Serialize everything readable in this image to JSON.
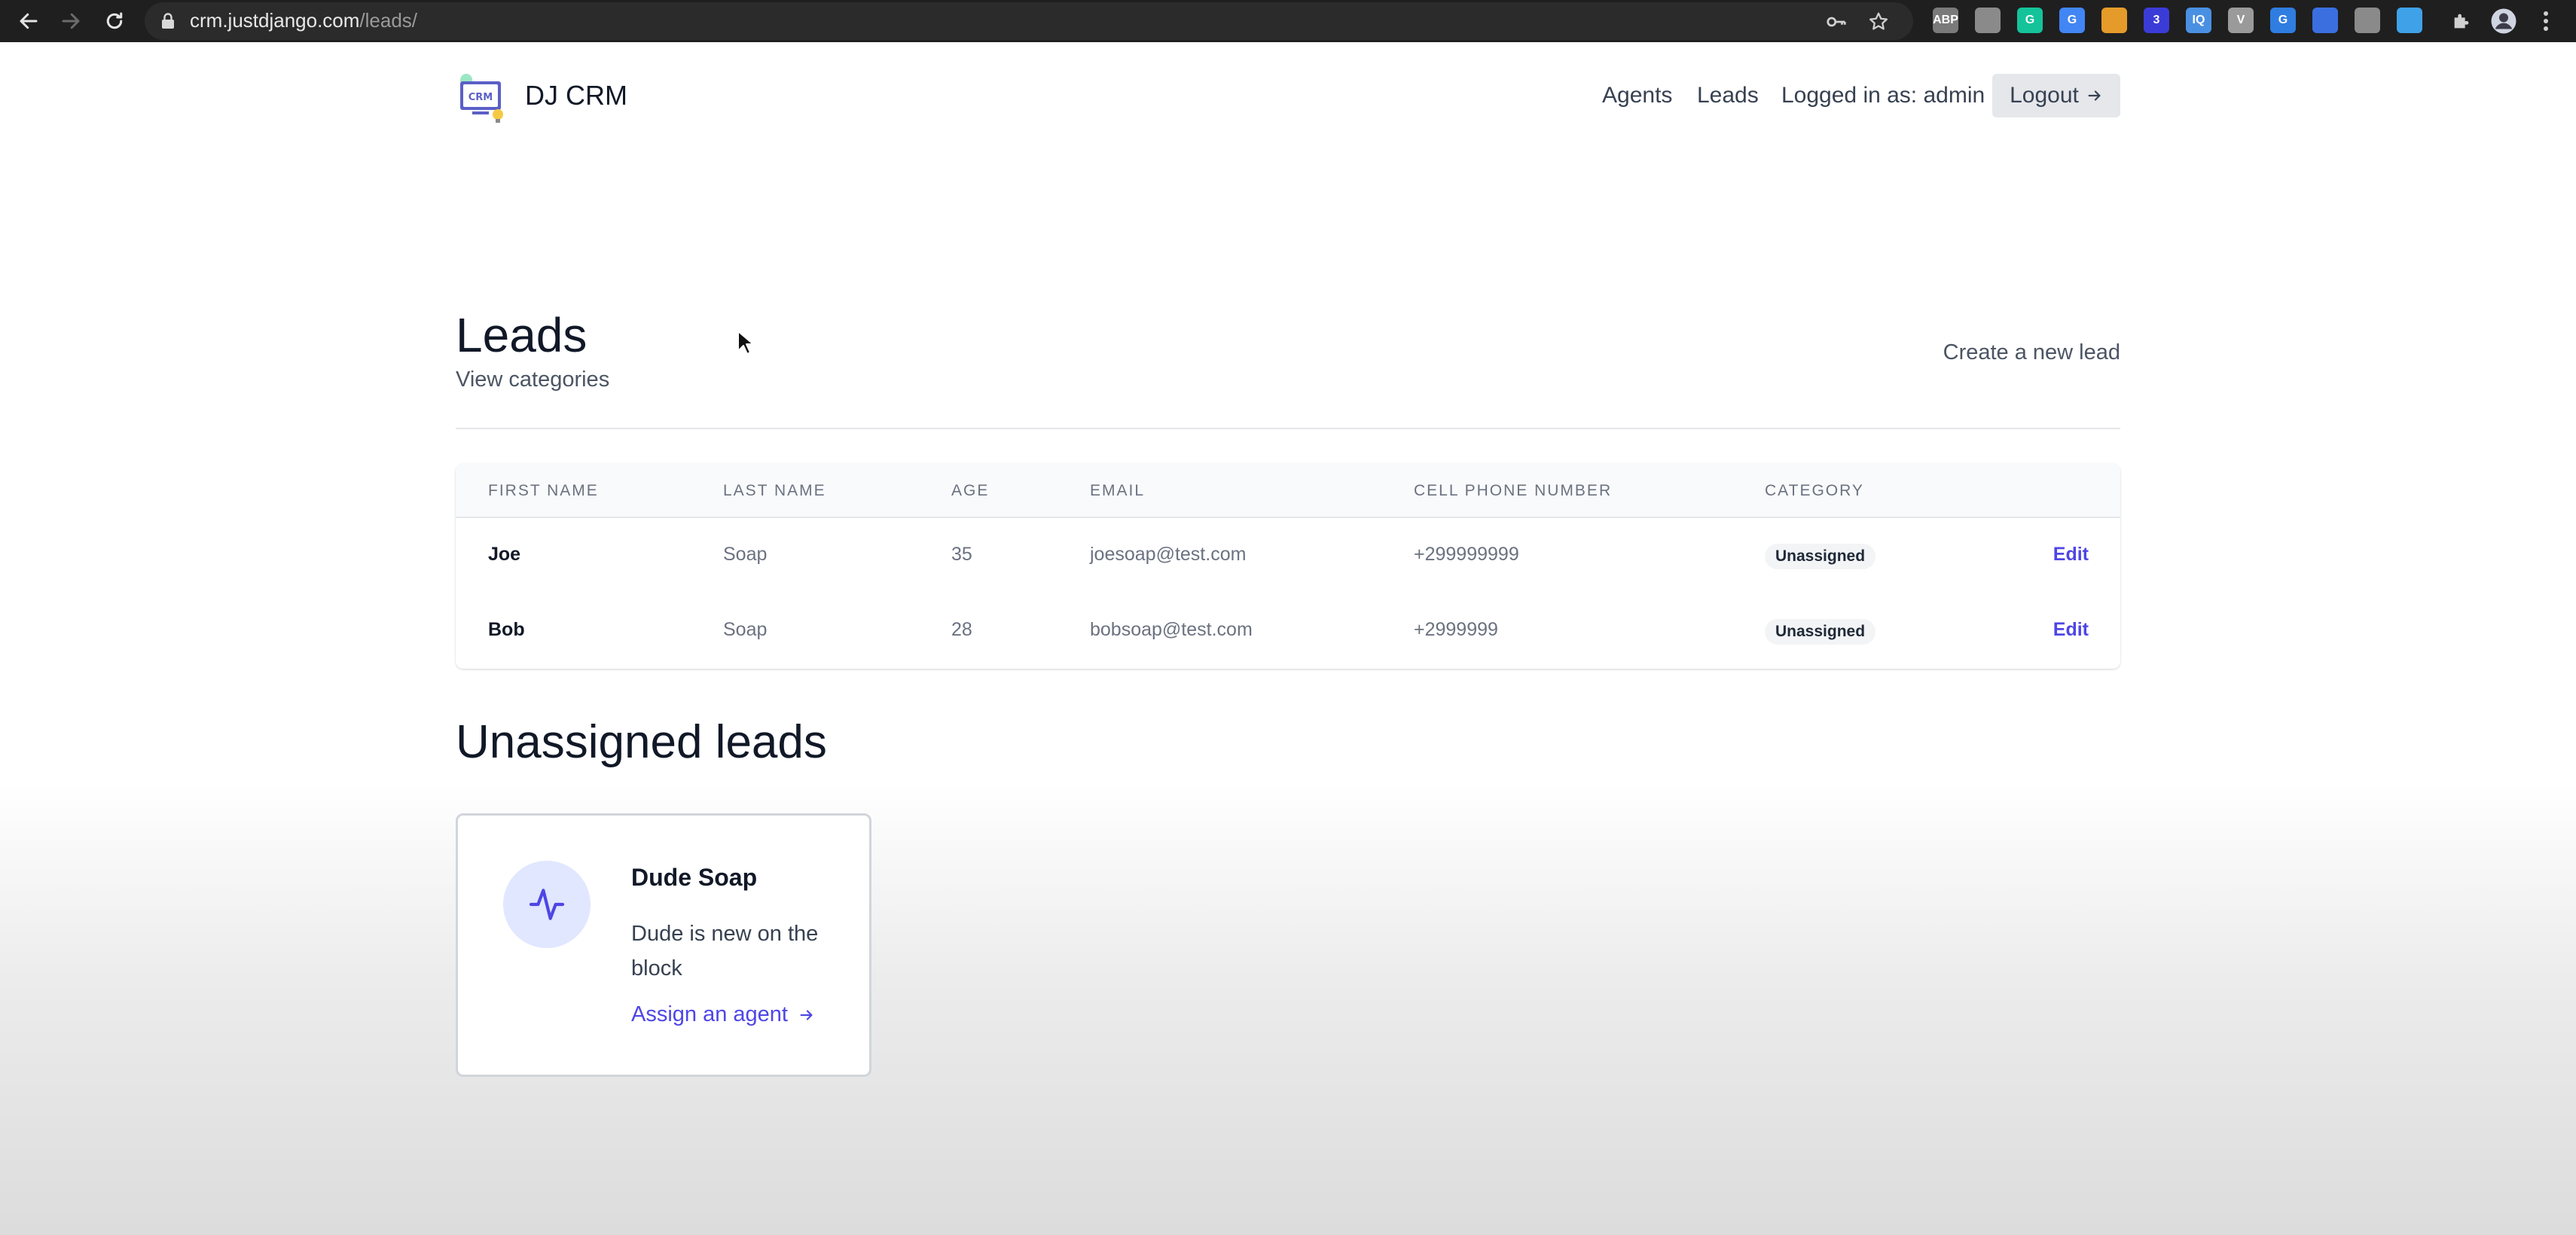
{
  "browser": {
    "url_host": "crm.justdjango.com",
    "url_path": "/leads/",
    "extensions": [
      {
        "name": "abp-extension-icon",
        "label": "ABP",
        "color": "#7a7a7a"
      },
      {
        "name": "extension-square-icon",
        "label": "",
        "color": "#8a8a8a"
      },
      {
        "name": "grammarly-icon",
        "label": "G",
        "color": "#15c39a"
      },
      {
        "name": "google-extension-icon",
        "label": "G",
        "color": "#4285f4"
      },
      {
        "name": "orange-extension-icon",
        "label": "",
        "color": "#e59b2a"
      },
      {
        "name": "blue-extension-icon",
        "label": "3",
        "color": "#3b3bd8"
      },
      {
        "name": "iq-extension-icon",
        "label": "IQ",
        "color": "#4a90e2"
      },
      {
        "name": "v-extension-icon",
        "label": "V",
        "color": "#9a9a9a"
      },
      {
        "name": "g-circle-extension-icon",
        "label": "G",
        "color": "#2f7de1"
      },
      {
        "name": "window-extension-icon",
        "label": "",
        "color": "#3b6fe0"
      },
      {
        "name": "notes-extension-icon",
        "label": "",
        "color": "#8a8a8a"
      },
      {
        "name": "filter-extension-icon",
        "label": "",
        "color": "#3fa2e8"
      }
    ]
  },
  "nav": {
    "brand": "DJ CRM",
    "logo_text": "CRM",
    "agents": "Agents",
    "leads": "Leads",
    "logged_in": "Logged in as: admin",
    "logout": "Logout"
  },
  "page": {
    "title": "Leads",
    "view_categories": "View categories",
    "create_lead": "Create a new lead"
  },
  "table": {
    "headers": {
      "first_name": "FIRST NAME",
      "last_name": "LAST NAME",
      "age": "AGE",
      "email": "EMAIL",
      "phone": "CELL PHONE NUMBER",
      "category": "CATEGORY"
    },
    "rows": [
      {
        "first_name": "Joe",
        "last_name": "Soap",
        "age": "35",
        "email": "joesoap@test.com",
        "phone": "+299999999",
        "category": "Unassigned",
        "action": "Edit"
      },
      {
        "first_name": "Bob",
        "last_name": "Soap",
        "age": "28",
        "email": "bobsoap@test.com",
        "phone": "+2999999",
        "category": "Unassigned",
        "action": "Edit"
      }
    ]
  },
  "unassigned": {
    "title": "Unassigned leads",
    "leads": [
      {
        "name": "Dude Soap",
        "description": "Dude is new on the block",
        "link": "Assign an agent"
      }
    ]
  },
  "colors": {
    "accent": "#4f46e5",
    "icon_circle": "#e0e7ff"
  }
}
